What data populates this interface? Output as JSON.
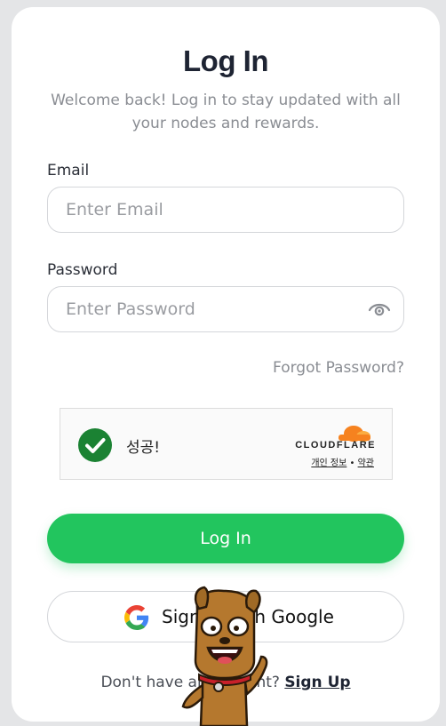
{
  "header": {
    "title": "Log In",
    "subtitle": "Welcome back! Log in to stay updated with all your nodes and rewards."
  },
  "email": {
    "label": "Email",
    "value": "",
    "placeholder": "Enter Email"
  },
  "password": {
    "label": "Password",
    "value": "",
    "placeholder": "Enter Password",
    "toggle_icon": "eye-icon"
  },
  "forgot_password": "Forgot Password?",
  "captcha": {
    "status": "성공!",
    "provider": "CLOUDFLARE",
    "privacy_link": "개인 정보",
    "separator": "•",
    "terms_link": "약관",
    "check_color": "#1b8233",
    "provider_color": "#f6821f"
  },
  "login_button": "Log In",
  "google_button": {
    "icon": "google-icon",
    "label": "Sign in with Google"
  },
  "footer": {
    "prompt": "Don't have an account?",
    "signup_link": "Sign Up"
  },
  "colors": {
    "accent": "#22c55e",
    "background": "#e4e5e7",
    "card": "#ffffff",
    "title": "#1e2433"
  },
  "overlay": {
    "icon": "dog-mascot-icon"
  }
}
